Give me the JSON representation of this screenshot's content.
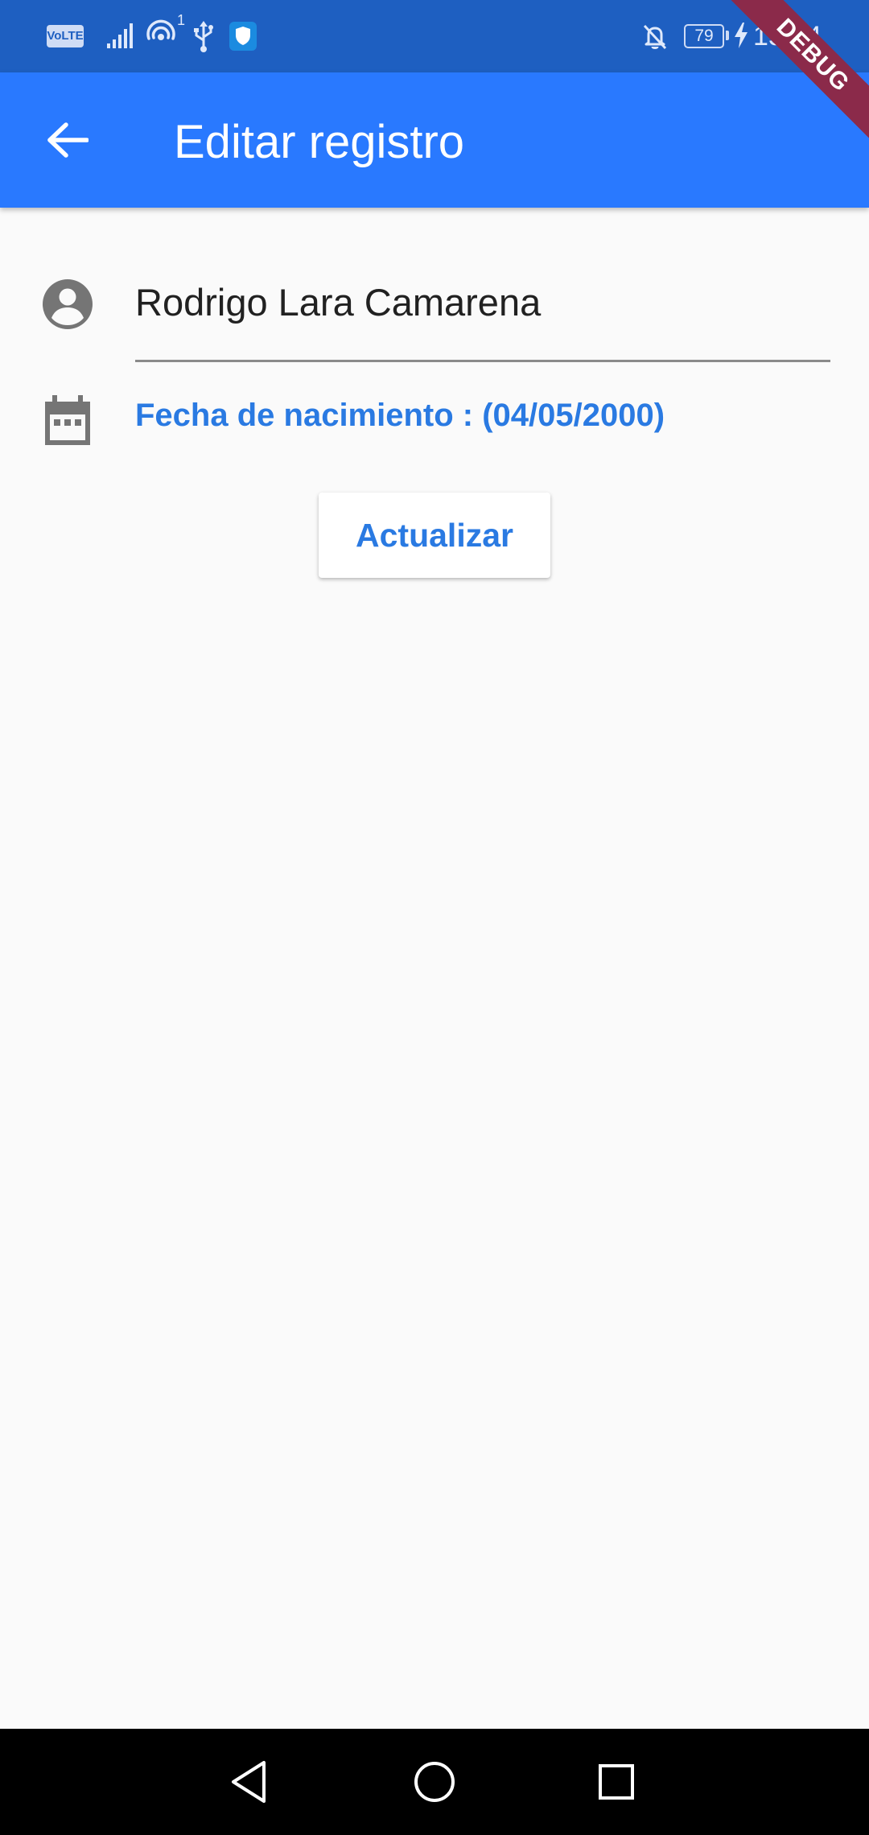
{
  "status_bar": {
    "network_label": "VoLTE",
    "hotspot_count": "1",
    "battery_level": "79",
    "time": "15:24",
    "icons": [
      "volte-icon",
      "signal-icon",
      "hotspot-icon",
      "usb-icon",
      "shield-icon",
      "bell-off-icon",
      "battery-icon",
      "charging-icon"
    ]
  },
  "debug_banner": "DEBUG",
  "app_bar": {
    "title": "Editar registro",
    "back_icon": "arrow-back-icon",
    "background": "#2979ff"
  },
  "form": {
    "name_icon": "account-circle-icon",
    "name_value": "Rodrigo Lara Camarena",
    "date_icon": "calendar-icon",
    "dob_label": "Fecha de nacimiento : (04/05/2000)",
    "accent_color": "#2a7ae2",
    "update_button_label": "Actualizar"
  },
  "nav_bar": {
    "icons": [
      "nav-back-icon",
      "nav-home-icon",
      "nav-recents-icon"
    ]
  }
}
